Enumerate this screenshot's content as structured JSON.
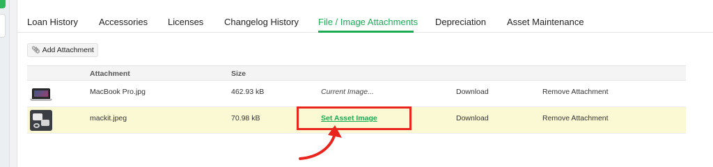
{
  "tabs": [
    {
      "label": "Loan History"
    },
    {
      "label": "Accessories"
    },
    {
      "label": "Licenses"
    },
    {
      "label": "Changelog History"
    },
    {
      "label": "File / Image Attachments"
    },
    {
      "label": "Depreciation"
    },
    {
      "label": "Asset Maintenance"
    }
  ],
  "active_tab": "File / Image Attachments",
  "toolbar": {
    "add_label": "Add Attachment",
    "add_icon": "paperclip-icon"
  },
  "table": {
    "headers": {
      "thumb": "",
      "attachment": "Attachment",
      "size": "Size"
    },
    "rows": [
      {
        "thumb_icon": "laptop-thumbnail",
        "name": "MacBook Pro.jpg",
        "size": "462.93 kB",
        "image_action": "Current Image...",
        "download": "Download",
        "remove": "Remove Attachment"
      },
      {
        "thumb_icon": "accessory-kit-thumbnail",
        "name": "mackit.jpeg",
        "size": "70.98 kB",
        "image_action": "Set Asset Image",
        "download": "Download",
        "remove": "Remove Attachment"
      }
    ]
  },
  "colors": {
    "accent": "#1bab55",
    "highlight_row": "#fbf8d4",
    "annotation": "#e8241c"
  }
}
